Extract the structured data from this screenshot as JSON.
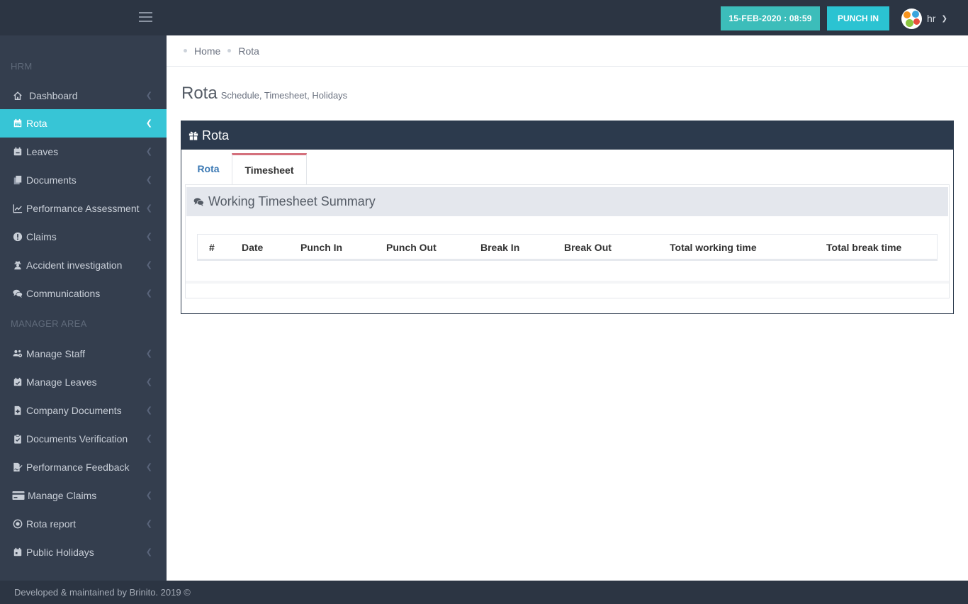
{
  "topbar": {
    "datetime": "15-FEB-2020 : 08:59",
    "punch_label": "PUNCH IN",
    "user": "hr"
  },
  "sidebar": {
    "section_hrm": "HRM",
    "section_manager": "MANAGER AREA",
    "items": [
      {
        "label": "Dashboard",
        "icon": "home-icon"
      },
      {
        "label": "Rota",
        "icon": "calendar-icon"
      },
      {
        "label": "Leaves",
        "icon": "calendar-minus-icon"
      },
      {
        "label": "Documents",
        "icon": "copy-icon"
      },
      {
        "label": "Performance Assessment",
        "icon": "line-chart-icon"
      },
      {
        "label": "Claims",
        "icon": "exclamation-circle-icon"
      },
      {
        "label": "Accident investigation",
        "icon": "user-secret-icon"
      },
      {
        "label": "Communications",
        "icon": "comments-icon"
      }
    ],
    "manager_items": [
      {
        "label": "Manage Staff",
        "icon": "users-cog-icon"
      },
      {
        "label": "Manage Leaves",
        "icon": "calendar-check-icon"
      },
      {
        "label": "Company Documents",
        "icon": "file-medical-icon"
      },
      {
        "label": "Documents Verification",
        "icon": "clipboard-check-icon"
      },
      {
        "label": "Performance Feedback",
        "icon": "file-signature-icon"
      },
      {
        "label": "Manage Claims",
        "icon": "credit-card-icon"
      },
      {
        "label": "Rota report",
        "icon": "dot-circle-icon"
      },
      {
        "label": "Public Holidays",
        "icon": "calendar-day-icon"
      }
    ]
  },
  "breadcrumb": [
    "Home",
    "Rota"
  ],
  "page": {
    "title": "Rota",
    "subtitle": "Schedule, Timesheet, Holidays"
  },
  "card": {
    "title": "Rota",
    "tabs": [
      "Rota",
      "Timesheet"
    ],
    "active_tab": "Timesheet",
    "panel_title": "Working Timesheet Summary",
    "columns": [
      "#",
      "Date",
      "Punch In",
      "Punch Out",
      "Break In",
      "Break Out",
      "Total working time",
      "Total break time"
    ]
  },
  "footer": {
    "text": "Developed & maintained by Brinito. 2019 ©"
  },
  "colors": {
    "topbar": "#2c3543",
    "sidebar": "#343e4e",
    "active": "#37c5d6",
    "date_badge": "#3cbdba",
    "punch_button": "#2bc3d2",
    "tab_accent": "#d4707c"
  }
}
